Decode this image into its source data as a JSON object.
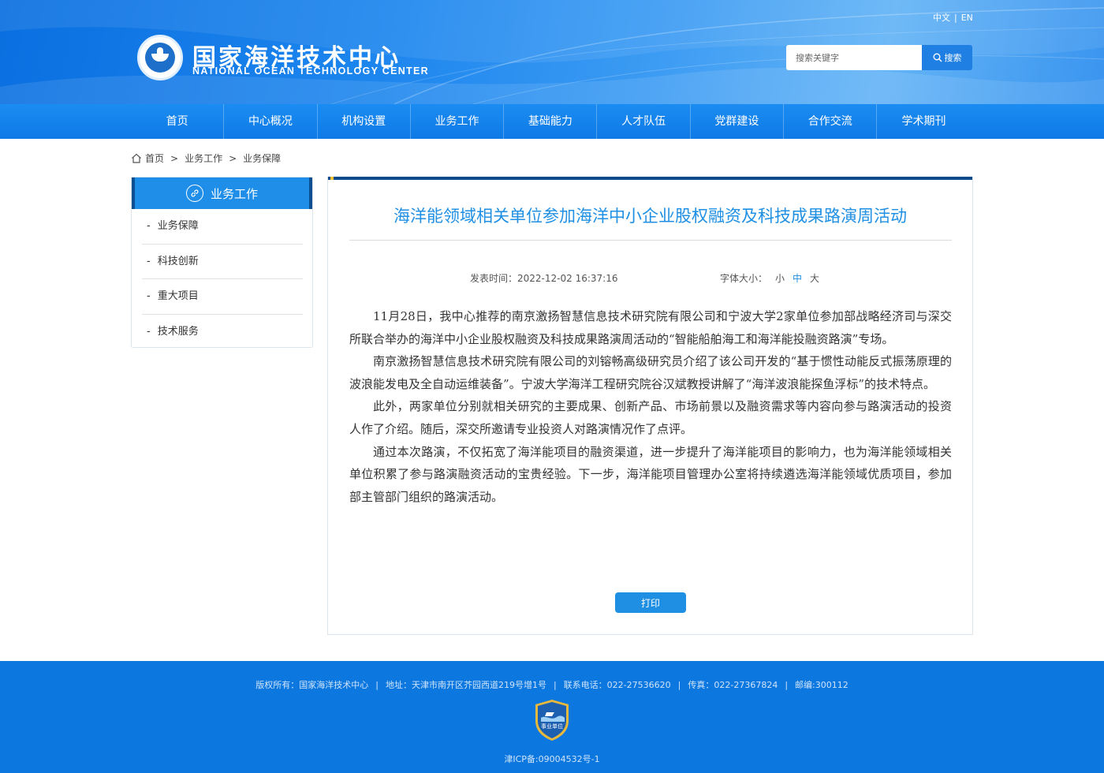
{
  "header": {
    "site_name_cn": "国家海洋技术中心",
    "site_name_en": "NATIONAL OCEAN TECHNOLOGY CENTER",
    "lang_cn": "中文",
    "lang_sep": "|",
    "lang_en": "EN",
    "search_placeholder": "搜索关键字",
    "search_button": "搜索"
  },
  "nav": [
    "首页",
    "中心概况",
    "机构设置",
    "业务工作",
    "基础能力",
    "人才队伍",
    "党群建设",
    "合作交流",
    "学术期刊"
  ],
  "breadcrumb": {
    "home": "首页",
    "sep": ">",
    "level1": "业务工作",
    "level2": "业务保障"
  },
  "sidebar": {
    "title": "业务工作",
    "items": [
      "业务保障",
      "科技创新",
      "重大项目",
      "技术服务"
    ],
    "dash": "-"
  },
  "article": {
    "title": "海洋能领域相关单位参加海洋中小企业股权融资及科技成果路演周活动",
    "publish_label": "发表时间：",
    "publish_time": "2022-12-02 16:37:16",
    "font_size_label": "字体大小：",
    "font_small": "小",
    "font_medium": "中",
    "font_large": "大",
    "paragraphs": [
      "11月28日，我中心推荐的南京激扬智慧信息技术研究院有限公司和宁波大学2家单位参加部战略经济司与深交所联合举办的海洋中小企业股权融资及科技成果路演周活动的“智能船舶海工和海洋能投融资路演”专场。",
      "南京激扬智慧信息技术研究院有限公司的刘镕畅高级研究员介绍了该公司开发的“基于惯性动能反式振荡原理的波浪能发电及全自动运维装备”。宁波大学海洋工程研究院谷汉斌教授讲解了“海洋波浪能探鱼浮标”的技术特点。",
      "此外，两家单位分别就相关研究的主要成果、创新产品、市场前景以及融资需求等内容向参与路演活动的投资人作了介绍。随后，深交所邀请专业投资人对路演情况作了点评。",
      "通过本次路演，不仅拓宽了海洋能项目的融资渠道，进一步提升了海洋能项目的影响力，也为海洋能领域相关单位积累了参与路演融资活动的宝贵经验。下一步，海洋能项目管理办公室将持续遴选海洋能领域优质项目，参加部主管部门组织的路演活动。"
    ],
    "print_button": "打印"
  },
  "footer": {
    "copyright": "版权所有：国家海洋技术中心",
    "address": "地址：天津市南开区芥园西道219号增1号",
    "phone": "联系电话：022-27536620",
    "fax": "传真：022-27367824",
    "postcode": "邮编:300112",
    "sep": "|",
    "badge_text": "事业单位",
    "icp": "津ICP备:09004532号-1"
  },
  "colors": {
    "primary": "#1f8fe3",
    "nav": "#0f7ae6",
    "footer": "#0d77e0",
    "sidebar_accent": "#0a4f91"
  }
}
